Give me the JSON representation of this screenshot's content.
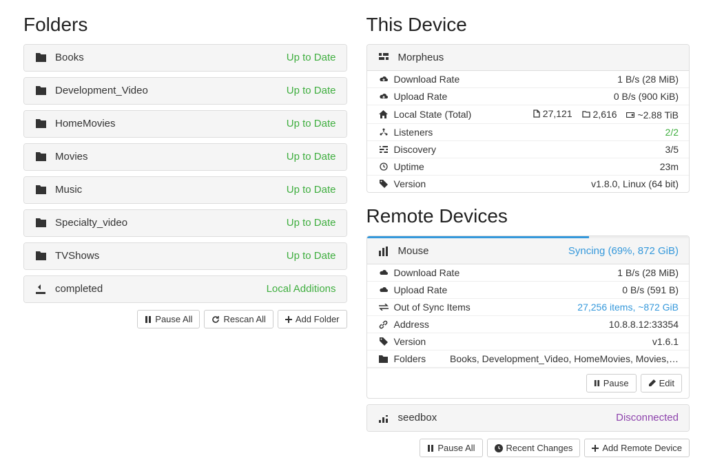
{
  "folders": {
    "heading": "Folders",
    "items": [
      {
        "name": "Books",
        "status": "Up to Date",
        "status_class": "green",
        "icon": "folder"
      },
      {
        "name": "Development_Video",
        "status": "Up to Date",
        "status_class": "green",
        "icon": "folder"
      },
      {
        "name": "HomeMovies",
        "status": "Up to Date",
        "status_class": "green",
        "icon": "folder"
      },
      {
        "name": "Movies",
        "status": "Up to Date",
        "status_class": "green",
        "icon": "folder"
      },
      {
        "name": "Music",
        "status": "Up to Date",
        "status_class": "green",
        "icon": "folder"
      },
      {
        "name": "Specialty_video",
        "status": "Up to Date",
        "status_class": "green",
        "icon": "folder"
      },
      {
        "name": "TVShows",
        "status": "Up to Date",
        "status_class": "green",
        "icon": "folder"
      },
      {
        "name": "completed",
        "status": "Local Additions",
        "status_class": "green",
        "icon": "download"
      }
    ],
    "buttons": {
      "pause_all": "Pause All",
      "rescan_all": "Rescan All",
      "add_folder": "Add Folder"
    }
  },
  "this_device": {
    "heading": "This Device",
    "name": "Morpheus",
    "rows": {
      "download_rate": {
        "label": "Download Rate",
        "value": "1 B/s (28 MiB)"
      },
      "upload_rate": {
        "label": "Upload Rate",
        "value": "0 B/s (900 KiB)"
      },
      "local_state": {
        "label": "Local State (Total)",
        "files": "27,121",
        "dirs": "2,616",
        "size": "~2.88 TiB"
      },
      "listeners": {
        "label": "Listeners",
        "value": "2/2",
        "value_class": "green"
      },
      "discovery": {
        "label": "Discovery",
        "value": "3/5"
      },
      "uptime": {
        "label": "Uptime",
        "value": "23m"
      },
      "version": {
        "label": "Version",
        "value": "v1.8.0, Linux (64 bit)"
      }
    }
  },
  "remote": {
    "heading": "Remote Devices",
    "devices": [
      {
        "name": "Mouse",
        "status": "Syncing (69%, 872 GiB)",
        "status_class": "blue",
        "progress": 69,
        "expanded": true,
        "rows": {
          "download_rate": {
            "label": "Download Rate",
            "value": "1 B/s (28 MiB)"
          },
          "upload_rate": {
            "label": "Upload Rate",
            "value": "0 B/s (591 B)"
          },
          "out_of_sync": {
            "label": "Out of Sync Items",
            "value": "27,256 items, ~872 GiB",
            "value_class": "blue"
          },
          "address": {
            "label": "Address",
            "value": "10.8.8.12:33354"
          },
          "version": {
            "label": "Version",
            "value": "v1.6.1"
          },
          "folders": {
            "label": "Folders",
            "value": "Books, Development_Video, HomeMovies, Movies,…"
          }
        },
        "buttons": {
          "pause": "Pause",
          "edit": "Edit"
        }
      },
      {
        "name": "seedbox",
        "status": "Disconnected",
        "status_class": "purple",
        "expanded": false
      }
    ],
    "buttons": {
      "pause_all": "Pause All",
      "recent_changes": "Recent Changes",
      "add_remote": "Add Remote Device"
    }
  }
}
